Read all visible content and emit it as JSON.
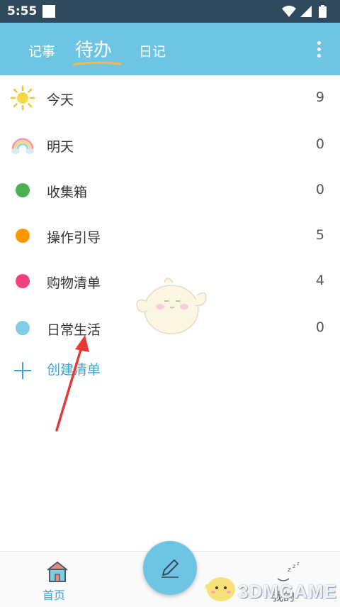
{
  "status_bar": {
    "time": "5:55"
  },
  "header": {
    "tabs": [
      {
        "label": "记事"
      },
      {
        "label": "待办"
      },
      {
        "label": "日记"
      }
    ]
  },
  "lists": [
    {
      "label": "今天",
      "count": "9",
      "icon": "sun-icon"
    },
    {
      "label": "明天",
      "count": "0",
      "icon": "rainbow-icon"
    },
    {
      "label": "收集箱",
      "count": "0",
      "color": "#4caf50"
    },
    {
      "label": "操作引导",
      "count": "5",
      "color": "#ff9800"
    },
    {
      "label": "购物清单",
      "count": "4",
      "color": "#f0427a"
    },
    {
      "label": "日常生活",
      "count": "0",
      "color": "#7ecfe6"
    }
  ],
  "create_list": {
    "label": "创建清单"
  },
  "bottom_nav": {
    "home_label": "首页",
    "mine_label": "我的"
  },
  "watermark": "3DMGAME",
  "colors": {
    "accent": "#6ec5e3",
    "link": "#3aa4d4"
  }
}
